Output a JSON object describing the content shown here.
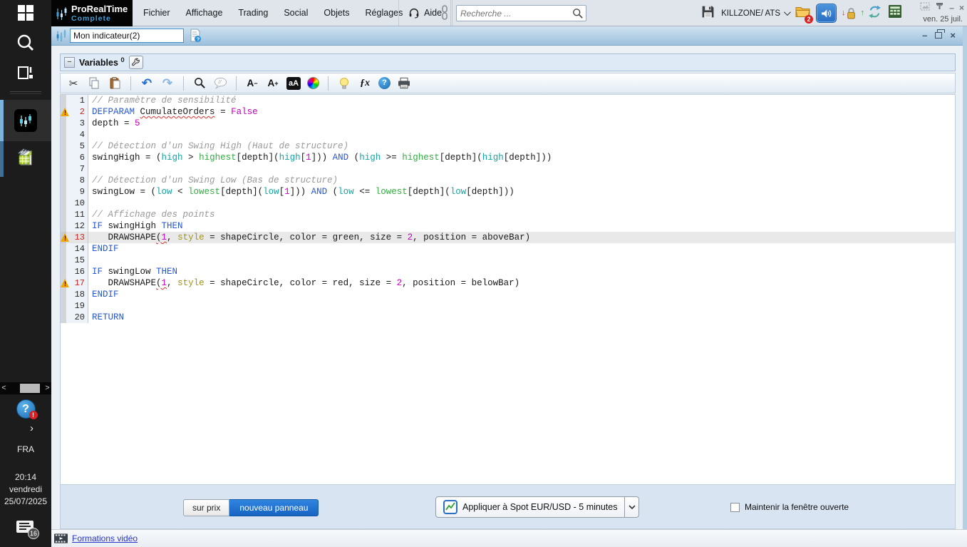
{
  "topbar": {
    "logo_title": "ProRealTime",
    "logo_subtitle": "Complete",
    "menus": [
      "Fichier",
      "Affichage",
      "Trading",
      "Social",
      "Objets",
      "Réglages"
    ],
    "aide_label": "Aide",
    "search_placeholder": "Recherche ...",
    "account_label": "KILLZONE/ ATS",
    "folder_badge": "2",
    "date_label": "ven. 25 juil."
  },
  "window": {
    "tab_name": "Mon indicateur(2)",
    "variables_label": "Variables",
    "variables_count": "0"
  },
  "editor": {
    "highlight_line": 13,
    "lines": [
      {
        "n": 1,
        "warn": false,
        "tokens": [
          [
            "c",
            "// Paramètre de sensibilité"
          ]
        ]
      },
      {
        "n": 2,
        "warn": true,
        "tokens": [
          [
            "k",
            "DEFPARAM"
          ],
          [
            "d",
            " "
          ],
          [
            "uw",
            "CumulateOrders"
          ],
          [
            "d",
            " = "
          ],
          [
            "m",
            "False"
          ]
        ]
      },
      {
        "n": 3,
        "warn": false,
        "tokens": [
          [
            "d",
            "depth = "
          ],
          [
            "m",
            "5"
          ]
        ]
      },
      {
        "n": 4,
        "warn": false,
        "tokens": []
      },
      {
        "n": 5,
        "warn": false,
        "tokens": [
          [
            "c",
            "// Détection d'un Swing High (Haut de structure)"
          ]
        ]
      },
      {
        "n": 6,
        "warn": false,
        "tokens": [
          [
            "d",
            "swingHigh = ("
          ],
          [
            "t",
            "high"
          ],
          [
            "d",
            " > "
          ],
          [
            "g",
            "highest"
          ],
          [
            "d",
            "[depth]("
          ],
          [
            "t",
            "high"
          ],
          [
            "d",
            "["
          ],
          [
            "m",
            "1"
          ],
          [
            "d",
            "])) "
          ],
          [
            "k",
            "AND"
          ],
          [
            "d",
            " ("
          ],
          [
            "t",
            "high"
          ],
          [
            "d",
            " >= "
          ],
          [
            "g",
            "highest"
          ],
          [
            "d",
            "[depth]("
          ],
          [
            "t",
            "high"
          ],
          [
            "d",
            "[depth]))"
          ]
        ]
      },
      {
        "n": 7,
        "warn": false,
        "tokens": []
      },
      {
        "n": 8,
        "warn": false,
        "tokens": [
          [
            "c",
            "// Détection d'un Swing Low (Bas de structure)"
          ]
        ]
      },
      {
        "n": 9,
        "warn": false,
        "tokens": [
          [
            "d",
            "swingLow = ("
          ],
          [
            "t",
            "low"
          ],
          [
            "d",
            " < "
          ],
          [
            "g",
            "lowest"
          ],
          [
            "d",
            "[depth]("
          ],
          [
            "t",
            "low"
          ],
          [
            "d",
            "["
          ],
          [
            "m",
            "1"
          ],
          [
            "d",
            "])) "
          ],
          [
            "k",
            "AND"
          ],
          [
            "d",
            " ("
          ],
          [
            "t",
            "low"
          ],
          [
            "d",
            " <= "
          ],
          [
            "g",
            "lowest"
          ],
          [
            "d",
            "[depth]("
          ],
          [
            "t",
            "low"
          ],
          [
            "d",
            "[depth]))"
          ]
        ]
      },
      {
        "n": 10,
        "warn": false,
        "tokens": []
      },
      {
        "n": 11,
        "warn": false,
        "tokens": [
          [
            "c",
            "// Affichage des points"
          ]
        ]
      },
      {
        "n": 12,
        "warn": false,
        "tokens": [
          [
            "k",
            "IF"
          ],
          [
            "d",
            " swingHigh "
          ],
          [
            "k",
            "THEN"
          ]
        ]
      },
      {
        "n": 13,
        "warn": true,
        "tokens": [
          [
            "d",
            "   DRAWSHAPE"
          ],
          [
            "du",
            "("
          ],
          [
            "mu",
            "1"
          ],
          [
            "d",
            ", "
          ],
          [
            "s",
            "style"
          ],
          [
            "d",
            " = shapeCircle, color = green, size = "
          ],
          [
            "m",
            "2"
          ],
          [
            "d",
            ", position = aboveBar)"
          ]
        ]
      },
      {
        "n": 14,
        "warn": false,
        "tokens": [
          [
            "k",
            "ENDIF"
          ]
        ]
      },
      {
        "n": 15,
        "warn": false,
        "tokens": []
      },
      {
        "n": 16,
        "warn": false,
        "tokens": [
          [
            "k",
            "IF"
          ],
          [
            "d",
            " swingLow "
          ],
          [
            "k",
            "THEN"
          ]
        ]
      },
      {
        "n": 17,
        "warn": true,
        "tokens": [
          [
            "d",
            "   DRAWSHAPE"
          ],
          [
            "du",
            "("
          ],
          [
            "mu",
            "1"
          ],
          [
            "d",
            ", "
          ],
          [
            "s",
            "style"
          ],
          [
            "d",
            " = shapeCircle, color = red, size = "
          ],
          [
            "m",
            "2"
          ],
          [
            "d",
            ", position = belowBar)"
          ]
        ]
      },
      {
        "n": 18,
        "warn": false,
        "tokens": [
          [
            "k",
            "ENDIF"
          ]
        ]
      },
      {
        "n": 19,
        "warn": false,
        "tokens": []
      },
      {
        "n": 20,
        "warn": false,
        "tokens": [
          [
            "k",
            "RETURN"
          ]
        ]
      }
    ]
  },
  "bottombar": {
    "btn_price": "sur prix",
    "btn_panel": "nouveau panneau",
    "apply_label": "Appliquer à Spot EUR/USD - 5 minutes",
    "checkbox_label": "Maintenir la fenêtre ouverte"
  },
  "sidebar": {
    "lang": "FRA",
    "time": "20:14",
    "day": "vendredi",
    "date": "25/07/2025",
    "chat_badge": "16"
  },
  "footer": {
    "link_label": "Formations vidéo"
  },
  "glyphs": {
    "cut": "✂",
    "undo": "↶",
    "redo": "↷",
    "font_a": "A",
    "minus_sup": "−",
    "plus_sup": "+",
    "aa": "aA",
    "fx": "ƒx",
    "question": "?",
    "warn_mark": "!",
    "win_min": "–",
    "win_close": "×",
    "corner_min": "–",
    "corner_close": "×",
    "scroll_left": "<",
    "scroll_right": ">",
    "expand_chevron": "›",
    "variables_minus": "−",
    "help_badge": "!"
  },
  "colors": {
    "accent_blue": "#1a70d6",
    "logo_subtitle_blue": "#3f9fd8",
    "warning_yellow": "#f0a500",
    "error_red": "#d02020",
    "keyword_blue": "#2857d0",
    "number_magenta": "#c400c4",
    "price_teal": "#17a3a3",
    "function_green": "#35ab44",
    "style_olive": "#a3941c",
    "comment_gray": "#999999",
    "sidebar_bg": "#1c1c1c",
    "titlebar_blue": "#9dc1dd"
  }
}
